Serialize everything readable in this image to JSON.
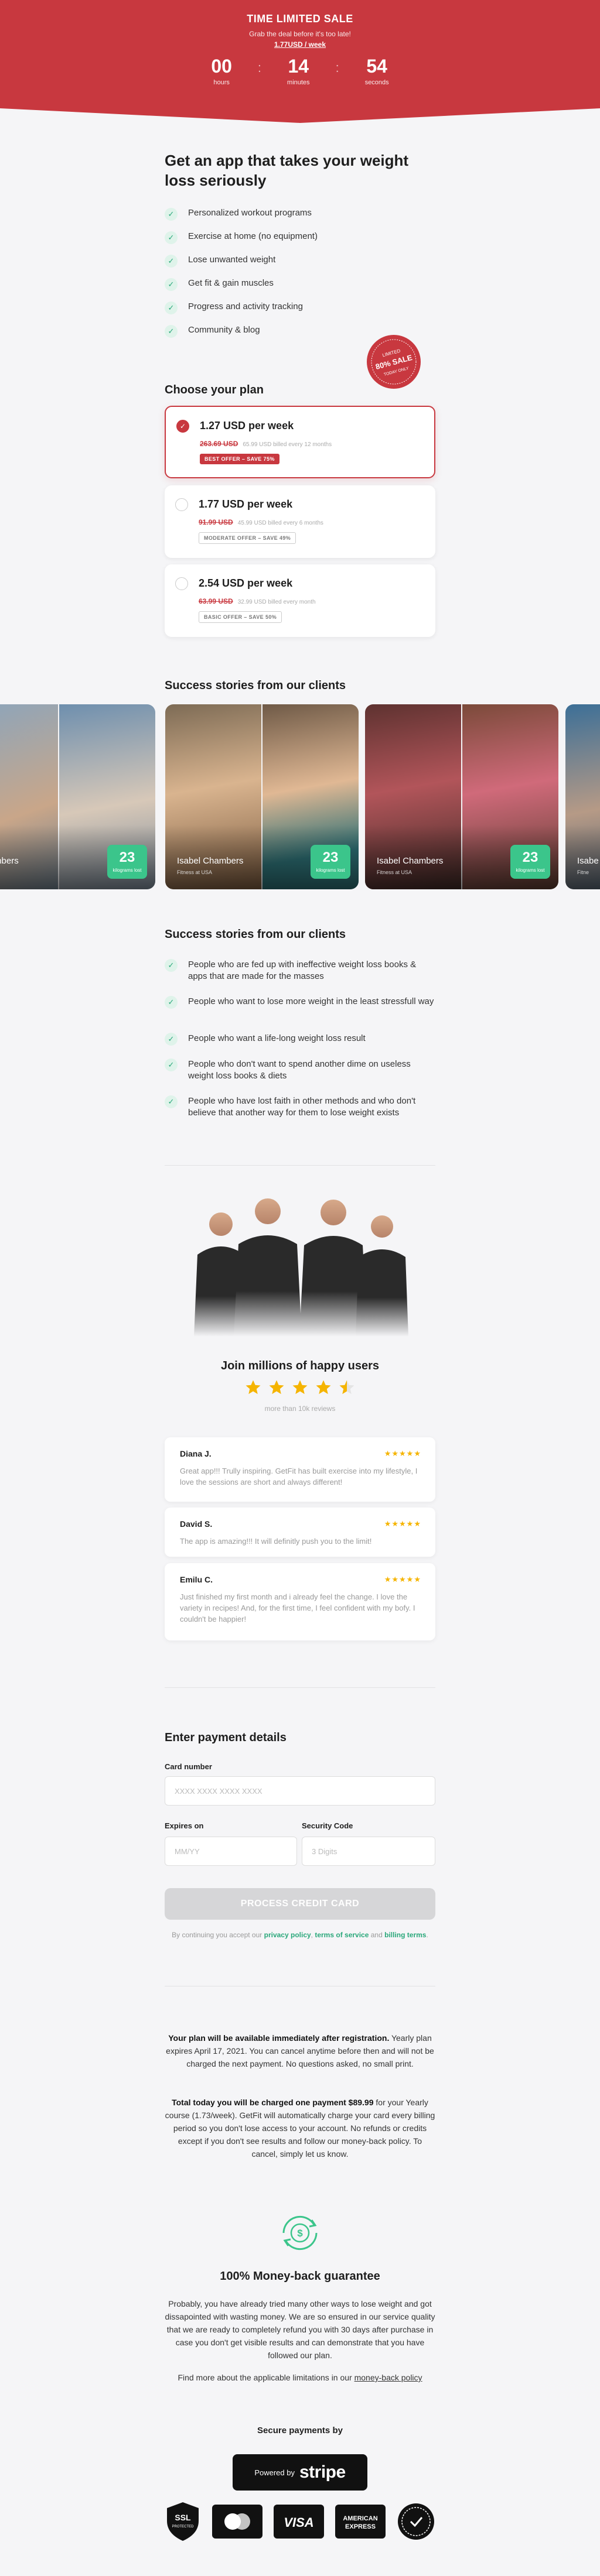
{
  "hero": {
    "title": "TIME LIMITED SALE",
    "subtitle": "Grab the deal before it's too late!",
    "price": "1.77USD / week",
    "timer": [
      {
        "value": "00",
        "label": "hours"
      },
      {
        "value": "14",
        "label": "minutes"
      },
      {
        "value": "54",
        "label": "seconds"
      }
    ],
    "color": "#c8383f"
  },
  "intro": {
    "heading": "Get an app that takes your weight loss seriously",
    "benefits": [
      "Personalized workout programs",
      "Exercise at home (no equipment)",
      "Lose unwanted weight",
      "Get fit & gain muscles",
      "Progress and activity tracking",
      "Community & blog"
    ]
  },
  "stamp": {
    "line1": "LIMITED",
    "line2": "80% SALE",
    "line3": "TODAY ONLY"
  },
  "plans": {
    "heading": "Choose your plan",
    "items": [
      {
        "title": "1.27 USD per week",
        "old_price": "263.69 USD",
        "billing": "65.99 USD billed every 12 months",
        "badge": "BEST OFFER – SAVE 75%",
        "selected": true
      },
      {
        "title": "1.77 USD per week",
        "old_price": "91.99 USD",
        "billing": "45.99 USD billed every 6 months",
        "badge": "MODERATE OFFER – SAVE 49%",
        "selected": false
      },
      {
        "title": "2.54 USD per week",
        "old_price": "63.99 USD",
        "billing": "32.99 USD billed every month",
        "badge": "BASIC OFFER – SAVE 50%",
        "selected": false
      }
    ]
  },
  "stories": {
    "heading": "Success stories from our clients",
    "cards": [
      {
        "name": "l Chambers",
        "role": "USA",
        "stat": "23",
        "stat_label": "kilograms lost"
      },
      {
        "name": "Isabel Chambers",
        "role": "Fitness at USA",
        "stat": "23",
        "stat_label": "kilograms lost"
      },
      {
        "name": "Isabel Chambers",
        "role": "Fitness at USA",
        "stat": "23",
        "stat_label": "kilograms lost"
      },
      {
        "name": "Isabe",
        "role": "Fitne",
        "stat": "",
        "stat_label": ""
      }
    ]
  },
  "audience": {
    "heading": "Success stories from our clients",
    "items": [
      "People who are fed up with ineffective weight loss books & apps that are made for the masses",
      "People who want to lose more weight in the least stressfull way",
      "People who want a life-long weight loss result",
      "People who don't want to spend another dime on useless weight loss books & diets",
      "People who have lost faith in other methods and who don't believe that another way for them to lose weight exists"
    ]
  },
  "social": {
    "heading": "Join millions of happy users",
    "rating_note": "more than 10k reviews",
    "stars": "★★★★★",
    "reviews": [
      {
        "name": "Diana J.",
        "stars": "★★★★★",
        "text": "Great app!!! Trully inspiring. GetFit has built exercise into my lifestyle, I love the sessions are short and always different!"
      },
      {
        "name": "David S.",
        "stars": "★★★★★",
        "text": "The app is amazing!!! It will definitly push you to the limit!"
      },
      {
        "name": "Emilu C.",
        "stars": "★★★★★",
        "text": "Just finished my first month and i already feel the change. I love the variety in recipes! And, for the first time, I feel confident with my bofy. I couldn't be happier!"
      }
    ]
  },
  "payment": {
    "heading": "Enter payment details",
    "card_label": "Card number",
    "card_placeholder": "XXXX XXXX XXXX XXXX",
    "expires_label": "Expires on",
    "expires_placeholder": "MM/YY",
    "cvc_label": "Security Code",
    "cvc_placeholder": "3 Digits",
    "button": "PROCESS CREDIT CARD",
    "terms_prefix": "By continuing you accept our",
    "privacy": "privacy policy",
    "terms": "terms of service",
    "and": "and",
    "billing": "billing terms",
    "period": "."
  },
  "info": {
    "p1_bold": "Your plan will be available immediately after registration.",
    "p1": "Yearly plan expires April 17, 2021. You can cancel anytime before then and will not be charged the next payment. No questions asked, no small print.",
    "p2_bold": "Total today you will be charged one payment $89.99",
    "p2": "for your Yearly course (1.73/week). GetFit will automatically charge your card every billing period so you don't lose access to your account. No refunds or credits except if you don't see results and follow our money-back policy. To cancel, simply let us know."
  },
  "guarantee": {
    "heading": "100% Money-back guarantee",
    "text": "Probably, you have already tried many other ways to lose weight and got dissapointed with wasting money. We are so ensured in our service quality that we are ready to completely refund you with 30 days after purchase in case you don't get visible results and can demonstrate that you have followed our plan.",
    "more_prefix": "Find more about the applicable limitations in our",
    "more_link": "money-back policy",
    "icon": "dollar-refresh-icon",
    "accent": "#3bc58b"
  },
  "secure": {
    "heading": "Secure payments by",
    "powered": "Powered by",
    "brand": "stripe",
    "badges": [
      {
        "icon": "ssl-shield-icon",
        "line1": "SSL",
        "line2": "PROTECTED"
      },
      {
        "icon": "mastercard-icon",
        "line1": "",
        "line2": ""
      },
      {
        "icon": "visa-icon",
        "line1": "VISA",
        "line2": ""
      },
      {
        "icon": "amex-icon",
        "line1": "AMERICAN",
        "line2": "EXPRESS"
      },
      {
        "icon": "secure-seal-icon",
        "line1": "",
        "line2": ""
      }
    ]
  }
}
